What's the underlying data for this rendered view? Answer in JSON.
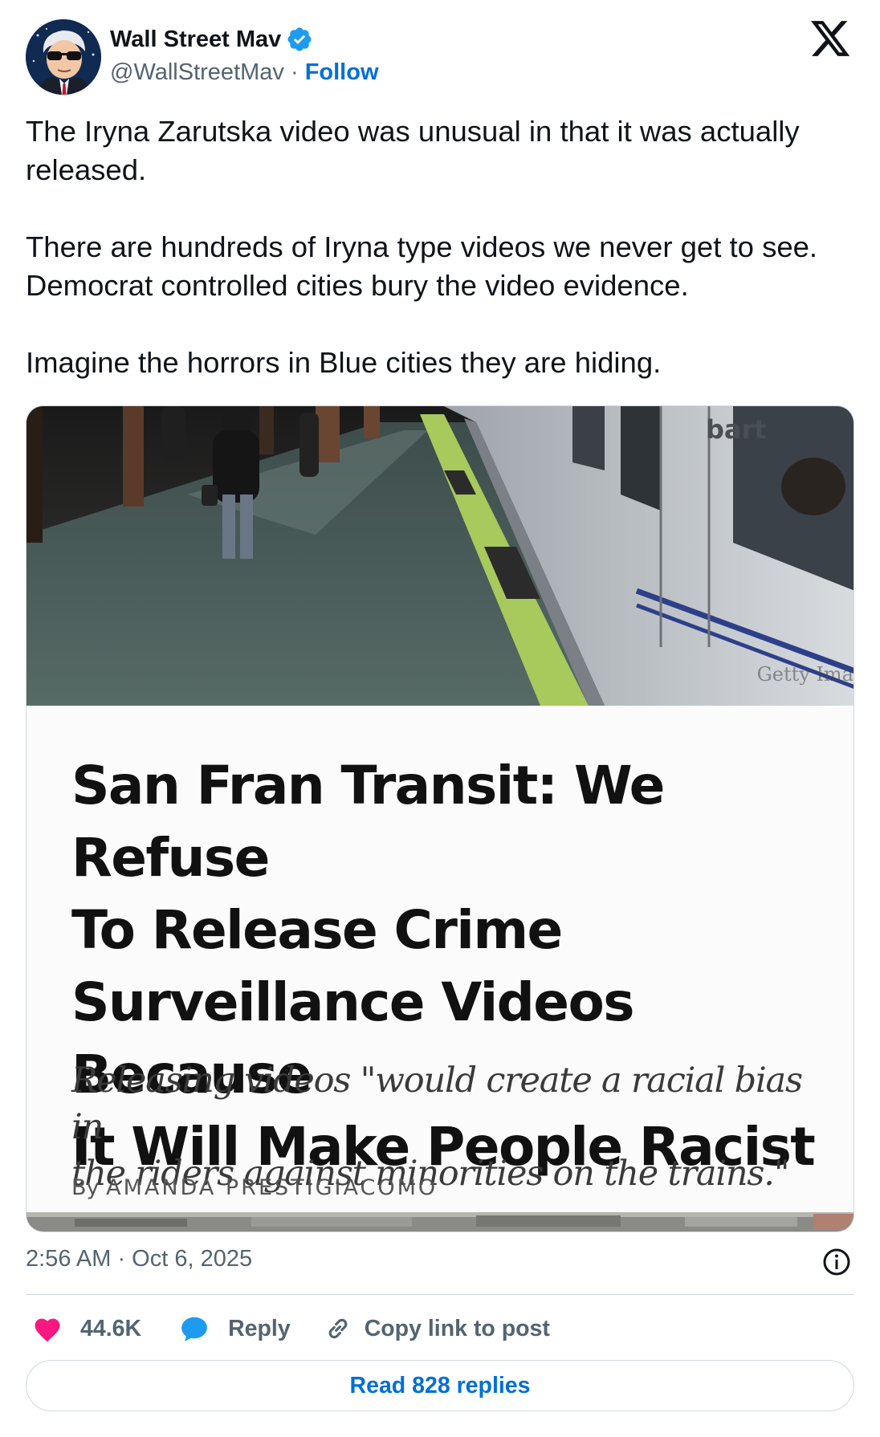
{
  "author": {
    "display_name": "Wall Street Mav",
    "handle": "@WallStreetMav",
    "separator": " · ",
    "follow_label": "Follow",
    "verified": true
  },
  "platform_logo": "x-logo-icon",
  "tweet": {
    "paragraphs": [
      "The Iryna Zarutska video was unusual in that it was actually released.",
      "There are hundreds of Iryna type videos we never get to see. Democrat controlled cities bury the video evidence.",
      "Imagine the horrors in Blue cities they are hiding."
    ]
  },
  "media": {
    "photo_watermark": "Getty Ima",
    "train_logo": "bart",
    "headline_lines": [
      "San Fran Transit: We Refuse",
      "To Release Crime",
      "Surveillance Videos Because",
      "It Will Make People Racist"
    ],
    "subhead_lines": [
      "Releasing videos \"would create a racial bias in",
      "the riders against minorities on the trains.\""
    ],
    "byline_prefix": "By ",
    "byline_name": "AMANDA PRESTIGIACOMO"
  },
  "footer": {
    "timestamp": "2:56 AM · Oct 6, 2025",
    "likes": "44.6K",
    "reply_label": "Reply",
    "copy_link_label": "Copy link to post",
    "read_replies_label": "Read 828 replies"
  },
  "colors": {
    "link_blue": "#006fd6",
    "like_pink": "#f91880",
    "reply_blue": "#1d9bf0",
    "muted_text": "#536471",
    "border": "#cfd9de"
  }
}
